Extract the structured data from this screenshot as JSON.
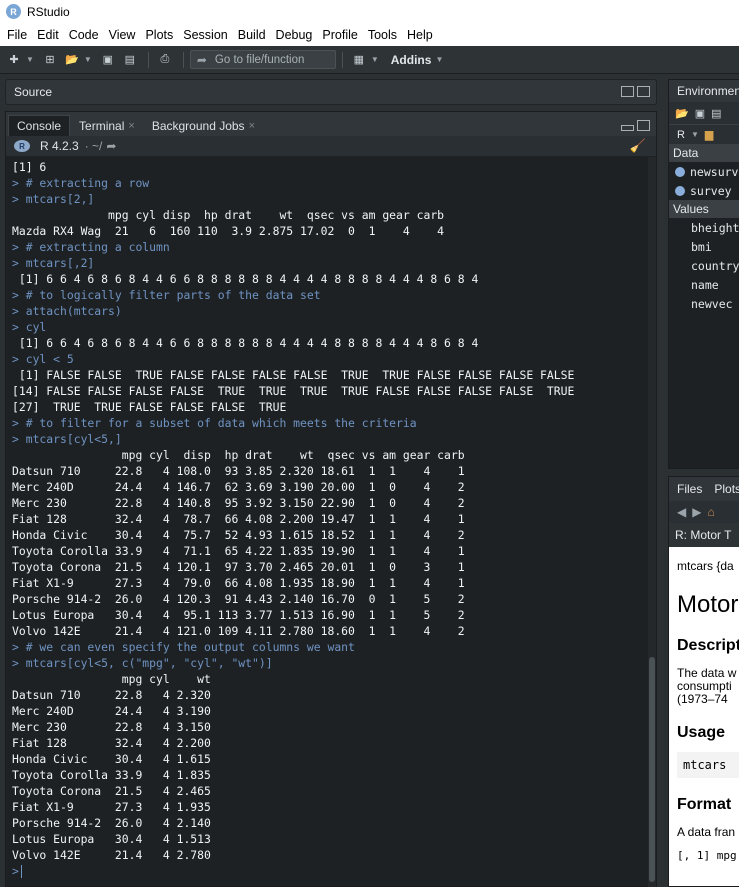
{
  "app": {
    "title": "RStudio",
    "icon": "R"
  },
  "menu": [
    "File",
    "Edit",
    "Code",
    "View",
    "Plots",
    "Session",
    "Build",
    "Debug",
    "Profile",
    "Tools",
    "Help"
  ],
  "toolbar": {
    "goto_label": "Go to file/function",
    "addins_label": "Addins"
  },
  "source_pane": {
    "title": "Source"
  },
  "console_tabs": [
    {
      "label": "Console",
      "closable": false
    },
    {
      "label": "Terminal",
      "closable": true
    },
    {
      "label": "Background Jobs",
      "closable": true
    }
  ],
  "console_header": {
    "r_version": "R 4.2.3",
    "path": "· ~/"
  },
  "console_lines": [
    {
      "kind": "out",
      "text": "[1] 6"
    },
    {
      "kind": "cmd",
      "text": "> # extracting a row"
    },
    {
      "kind": "cmd",
      "text": "> mtcars[2,]"
    },
    {
      "kind": "out",
      "text": "              mpg cyl disp  hp drat    wt  qsec vs am gear carb"
    },
    {
      "kind": "out",
      "text": "Mazda RX4 Wag  21   6  160 110  3.9 2.875 17.02  0  1    4    4"
    },
    {
      "kind": "cmd",
      "text": "> # extracting a column"
    },
    {
      "kind": "cmd",
      "text": "> mtcars[,2]"
    },
    {
      "kind": "out",
      "text": " [1] 6 6 4 6 8 6 8 4 4 6 6 8 8 8 8 8 8 4 4 4 4 8 8 8 8 4 4 4 8 6 8 4"
    },
    {
      "kind": "cmd",
      "text": "> # to logically filter parts of the data set"
    },
    {
      "kind": "cmd",
      "text": "> attach(mtcars)"
    },
    {
      "kind": "cmd",
      "text": "> cyl"
    },
    {
      "kind": "out",
      "text": " [1] 6 6 4 6 8 6 8 4 4 6 6 8 8 8 8 8 8 4 4 4 4 8 8 8 8 4 4 4 8 6 8 4"
    },
    {
      "kind": "cmd",
      "text": "> cyl < 5"
    },
    {
      "kind": "out",
      "text": " [1] FALSE FALSE  TRUE FALSE FALSE FALSE FALSE  TRUE  TRUE FALSE FALSE FALSE FALSE"
    },
    {
      "kind": "out",
      "text": "[14] FALSE FALSE FALSE FALSE  TRUE  TRUE  TRUE  TRUE FALSE FALSE FALSE FALSE  TRUE"
    },
    {
      "kind": "out",
      "text": "[27]  TRUE  TRUE FALSE FALSE FALSE  TRUE"
    },
    {
      "kind": "cmd",
      "text": "> # to filter for a subset of data which meets the criteria"
    },
    {
      "kind": "cmd",
      "text": "> mtcars[cyl<5,]"
    },
    {
      "kind": "out",
      "text": "                mpg cyl  disp  hp drat    wt  qsec vs am gear carb"
    },
    {
      "kind": "out",
      "text": "Datsun 710     22.8   4 108.0  93 3.85 2.320 18.61  1  1    4    1"
    },
    {
      "kind": "out",
      "text": "Merc 240D      24.4   4 146.7  62 3.69 3.190 20.00  1  0    4    2"
    },
    {
      "kind": "out",
      "text": "Merc 230       22.8   4 140.8  95 3.92 3.150 22.90  1  0    4    2"
    },
    {
      "kind": "out",
      "text": "Fiat 128       32.4   4  78.7  66 4.08 2.200 19.47  1  1    4    1"
    },
    {
      "kind": "out",
      "text": "Honda Civic    30.4   4  75.7  52 4.93 1.615 18.52  1  1    4    2"
    },
    {
      "kind": "out",
      "text": "Toyota Corolla 33.9   4  71.1  65 4.22 1.835 19.90  1  1    4    1"
    },
    {
      "kind": "out",
      "text": "Toyota Corona  21.5   4 120.1  97 3.70 2.465 20.01  1  0    3    1"
    },
    {
      "kind": "out",
      "text": "Fiat X1-9      27.3   4  79.0  66 4.08 1.935 18.90  1  1    4    1"
    },
    {
      "kind": "out",
      "text": "Porsche 914-2  26.0   4 120.3  91 4.43 2.140 16.70  0  1    5    2"
    },
    {
      "kind": "out",
      "text": "Lotus Europa   30.4   4  95.1 113 3.77 1.513 16.90  1  1    5    2"
    },
    {
      "kind": "out",
      "text": "Volvo 142E     21.4   4 121.0 109 4.11 2.780 18.60  1  1    4    2"
    },
    {
      "kind": "cmd",
      "text": "> # we can even specify the output columns we want"
    },
    {
      "kind": "cmd",
      "text": "> mtcars[cyl<5, c(\"mpg\", \"cyl\", \"wt\")]"
    },
    {
      "kind": "out",
      "text": "                mpg cyl    wt"
    },
    {
      "kind": "out",
      "text": "Datsun 710     22.8   4 2.320"
    },
    {
      "kind": "out",
      "text": "Merc 240D      24.4   4 3.190"
    },
    {
      "kind": "out",
      "text": "Merc 230       22.8   4 3.150"
    },
    {
      "kind": "out",
      "text": "Fiat 128       32.4   4 2.200"
    },
    {
      "kind": "out",
      "text": "Honda Civic    30.4   4 1.615"
    },
    {
      "kind": "out",
      "text": "Toyota Corolla 33.9   4 1.835"
    },
    {
      "kind": "out",
      "text": "Toyota Corona  21.5   4 2.465"
    },
    {
      "kind": "out",
      "text": "Fiat X1-9      27.3   4 1.935"
    },
    {
      "kind": "out",
      "text": "Porsche 914-2  26.0   4 2.140"
    },
    {
      "kind": "out",
      "text": "Lotus Europa   30.4   4 1.513"
    },
    {
      "kind": "out",
      "text": "Volvo 142E     21.4   4 2.780"
    }
  ],
  "console_prompt": ">",
  "environment": {
    "tab_label": "Environment",
    "r_label": "R",
    "data_header": "Data",
    "data_items": [
      "newsurv",
      "survey"
    ],
    "values_header": "Values",
    "value_items": [
      "bheight",
      "bmi",
      "country",
      "name",
      "newvec"
    ]
  },
  "help": {
    "tabs": [
      "Files",
      "Plots"
    ],
    "title": "R: Motor T",
    "subtitle": "mtcars {da",
    "heading": "Motor",
    "description_header": "Descript",
    "description_lines": [
      "The data w",
      "consumpti",
      "(1973–74"
    ],
    "usage_header": "Usage",
    "usage_code": "mtcars",
    "format_header": "Format",
    "format_text": "A data fran",
    "format_code": "[, 1] mpg"
  },
  "colors": {
    "console_bg": "#1e2124",
    "command_blue": "#6f93c2",
    "output_text": "#f1f3f4",
    "chrome": "#30363a"
  }
}
